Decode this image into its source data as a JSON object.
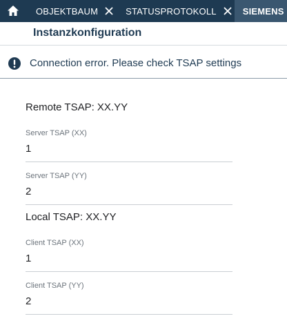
{
  "tabs": [
    {
      "label": "OBJEKTBAUM",
      "close_icon": "close-icon"
    },
    {
      "label": "STATUSPROTOKOLL",
      "close_icon": "close-icon"
    },
    {
      "label": "SIEMENS"
    }
  ],
  "home_icon": "home-icon",
  "header": {
    "title": "Instanzkonfiguration"
  },
  "banner": {
    "icon": "alert-circle-icon",
    "message": "Connection error. Please check TSAP settings"
  },
  "remote": {
    "title": "Remote TSAP: XX.YY",
    "server_xx": {
      "label": "Server TSAP (XX)",
      "value": "1"
    },
    "server_yy": {
      "label": "Server TSAP (YY)",
      "value": "2"
    }
  },
  "local": {
    "title": "Local TSAP: XX.YY",
    "client_xx": {
      "label": "Client TSAP (XX)",
      "value": "1"
    },
    "client_yy": {
      "label": "Client TSAP (YY)",
      "value": "2"
    }
  },
  "colors": {
    "tabbar": "#1e3a52",
    "active_tab": "#3a5770",
    "accent_text": "#1e3a52"
  }
}
